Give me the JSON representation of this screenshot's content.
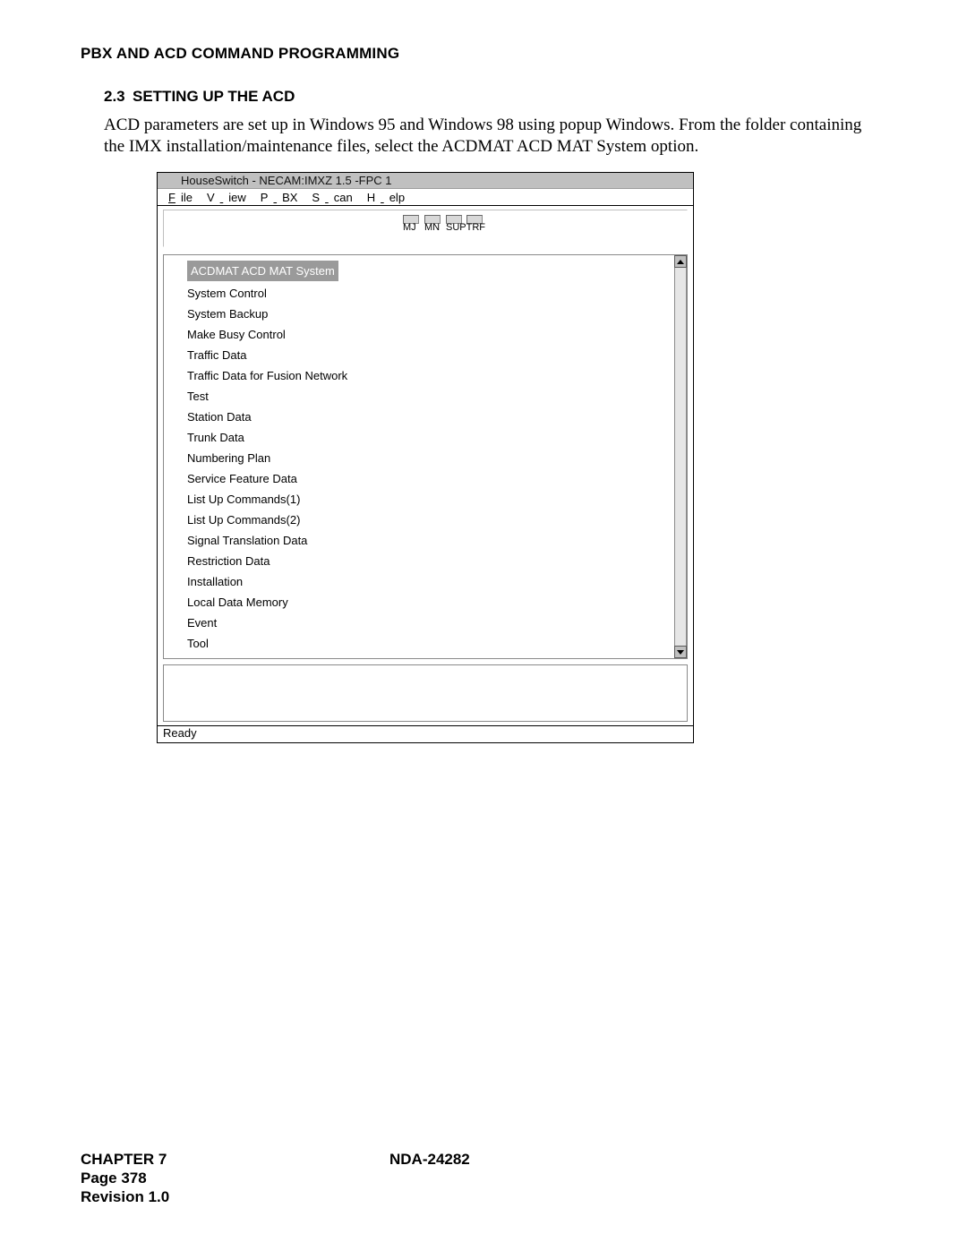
{
  "header": "PBX AND ACD COMMAND PROGRAMMING",
  "section": {
    "num": "2.3",
    "title": "SETTING UP THE ACD"
  },
  "body": "ACD parameters are set up in Windows 95 and Windows 98 using popup Windows. From the folder containing the IMX installation/maintenance files, select the ACDMAT ACD MAT System option.",
  "window": {
    "title": "HouseSwitch - NECAM:IMXZ 1.5 -FPC 1",
    "menus": {
      "file_u": "F",
      "file_r": "ile",
      "view_pre": "V",
      "view_gap": "   ",
      "view_r": "iew",
      "pbx_pre": "P",
      "pbx_gap": "   ",
      "pbx_r": "BX",
      "scan_pre": "S",
      "scan_gap": "   ",
      "scan_r": "can",
      "help_pre": "H",
      "help_gap": "   ",
      "help_r": "elp"
    },
    "indicators": {
      "mj": "MJ",
      "mn": "MN",
      "sup": "SUP",
      "trf": "TRF"
    },
    "tree_root": "ACDMAT ACD MAT System",
    "tree": [
      "System Control",
      "System Backup",
      "Make Busy Control",
      "Traffic Data",
      "Traffic Data for Fusion Network",
      "Test",
      "Station Data",
      "Trunk Data",
      "Numbering Plan",
      "Service Feature Data",
      "List Up Commands(1)",
      "List Up Commands(2)",
      "Signal Translation Data",
      "Restriction Data",
      "Installation",
      "Local Data Memory",
      "Event",
      "Tool"
    ],
    "status": "Ready"
  },
  "footer": {
    "chapter": "CHAPTER 7",
    "page": "Page 378",
    "rev": "Revision 1.0",
    "doc": "NDA-24282"
  }
}
